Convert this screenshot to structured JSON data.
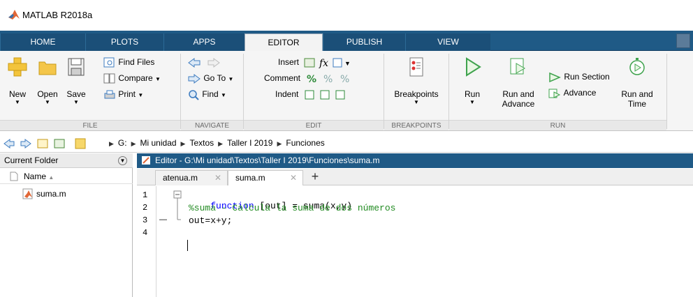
{
  "window": {
    "title": "MATLAB R2018a"
  },
  "tabs": [
    "HOME",
    "PLOTS",
    "APPS",
    "EDITOR",
    "PUBLISH",
    "VIEW"
  ],
  "toolstrip": {
    "file": {
      "label": "FILE",
      "new": "New",
      "open": "Open",
      "save": "Save",
      "find_files": "Find Files",
      "compare": "Compare",
      "print": "Print"
    },
    "navigate": {
      "label": "NAVIGATE",
      "goto": "Go To",
      "find": "Find"
    },
    "edit": {
      "label": "EDIT",
      "insert": "Insert",
      "comment": "Comment",
      "indent": "Indent"
    },
    "breakpoints": {
      "label": "BREAKPOINTS",
      "button": "Breakpoints"
    },
    "run": {
      "label": "RUN",
      "run": "Run",
      "run_and_advance_1": "Run and",
      "run_and_advance_2": "Advance",
      "run_section": "Run Section",
      "advance": "Advance",
      "run_and_time_1": "Run and",
      "run_and_time_2": "Time"
    }
  },
  "address": {
    "crumbs": [
      "G:",
      "Mi unidad",
      "Textos",
      "Taller I 2019",
      "Funciones"
    ]
  },
  "current_folder": {
    "title": "Current Folder",
    "column_name": "Name",
    "files": [
      "suma.m"
    ]
  },
  "editor": {
    "title": "Editor - G:\\Mi unidad\\Textos\\Taller I 2019\\Funciones\\suma.m",
    "tabs": [
      "atenua.m",
      "suma.m"
    ],
    "line_numbers": [
      "1",
      "2",
      "3",
      "4"
    ],
    "line3_marker": "—",
    "code": {
      "line1_kw": "function",
      "line1_rest": " [out] = suma(x,y)",
      "line2": "%suma - Calcula la suma de dos números",
      "line3": "out=x+y;"
    }
  }
}
